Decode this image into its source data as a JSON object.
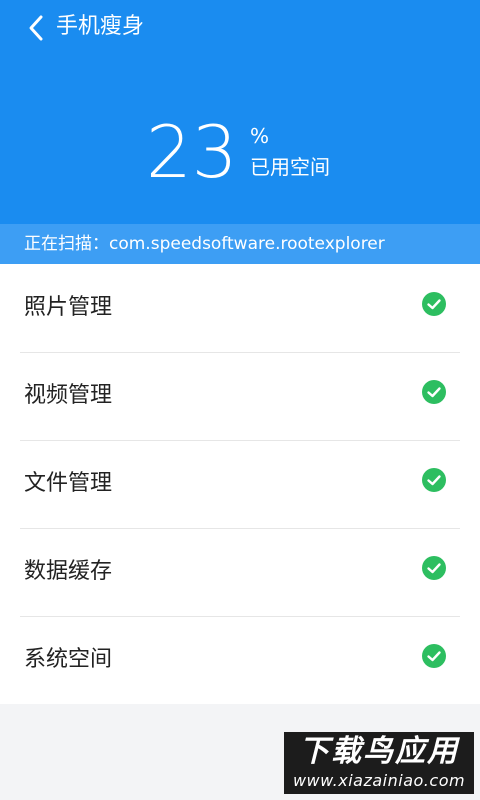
{
  "header": {
    "back_icon": "chevron-left-icon",
    "title": "手机瘦身",
    "usage_percent": "23",
    "percent_sign": "%",
    "used_label": "已用空间"
  },
  "scan": {
    "text": "正在扫描：com.speedsoftware.rootexplorer"
  },
  "items": [
    {
      "label": "照片管理",
      "status_icon": "check-circle-icon"
    },
    {
      "label": "视频管理",
      "status_icon": "check-circle-icon"
    },
    {
      "label": "文件管理",
      "status_icon": "check-circle-icon"
    },
    {
      "label": "数据缓存",
      "status_icon": "check-circle-icon"
    },
    {
      "label": "系统空间",
      "status_icon": "check-circle-icon"
    }
  ],
  "watermark": {
    "title": "下载鸟应用",
    "url": "www.xiazainiao.com"
  },
  "colors": {
    "primary": "#1a8cf0",
    "scan_bar": "#3d9ef4",
    "check": "#2dbe60"
  }
}
